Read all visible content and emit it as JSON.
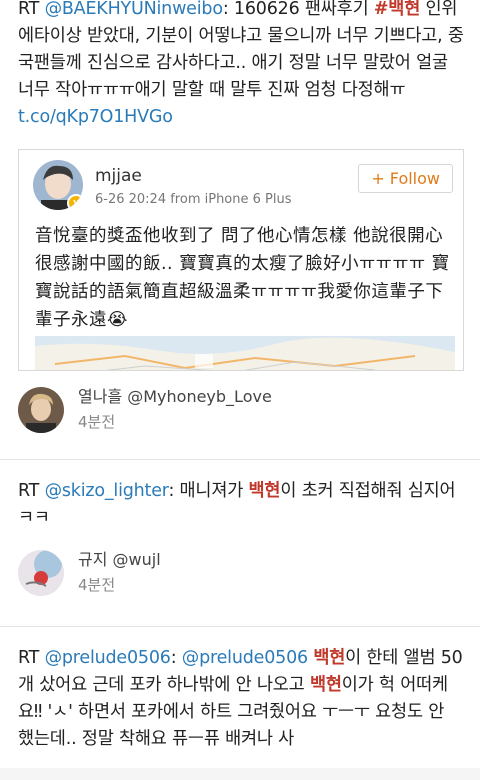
{
  "tweets": [
    {
      "rt": "RT",
      "handle": "@BAEKHYUNinweibo",
      "text_a": ": 160626 팬싸후기 ",
      "hashtag": "#백현",
      "text_b": " 인위에타이상 받았대, 기분이 어떻냐고 물으니까 너무 기쁘다고, 중국팬들께 진심으로 감사하다고.. 애기 정말 너무 말랐어 얼굴 너무 작아ㅠㅠㅠ애기 말할 때 말투 진짜 엄청 다정해ㅠ ",
      "link": "t.co/qKp7O1HVGo",
      "card": {
        "name": "mjjae",
        "meta": "6-26 20:24  from iPhone 6 Plus",
        "follow_label": "+ Follow",
        "body": "音悅臺的獎盃他收到了 問了他心情怎樣 他說很開心很感謝中國的飯.. 寶寶真的太瘦了臉好小ㅠㅠㅠㅠ 寶寶說話的語氣簡直超級溫柔ㅠㅠㅠㅠ我愛你這輩子下輩子永遠😭"
      },
      "author": {
        "name": "열나흘 @Myhoneyb_Love",
        "time": "4분전"
      }
    },
    {
      "rt": "RT",
      "handle": "@skizo_lighter",
      "text_a": ": 매니져가 ",
      "kw": "백현",
      "text_b": "이 초커 직접해줘 심지어ㅋㅋ",
      "author": {
        "name": "규지 @wujl",
        "time": "4분전"
      }
    },
    {
      "rt": "RT",
      "handle1": "@prelude0506",
      "sep": ": ",
      "handle2": "@prelude0506",
      "kw1": "백현",
      "text_a": "이 한테 앨범 50개 샀어요 근데 포카 하나밖에 안 나오고 ",
      "kw2": "백현",
      "text_b": "이가 헉 어떠케요‼ 'ㅅ' 하면서 포카에서 하트 그려줬어요 ㅜㅡㅜ 요청도 안 했는데.. 정말 착해요 퓨ㅡ퓨 배켜나 사"
    }
  ],
  "colors": {
    "link": "#2b7bb9",
    "follow": "#e07b1a",
    "keyword": "#c0392b"
  }
}
